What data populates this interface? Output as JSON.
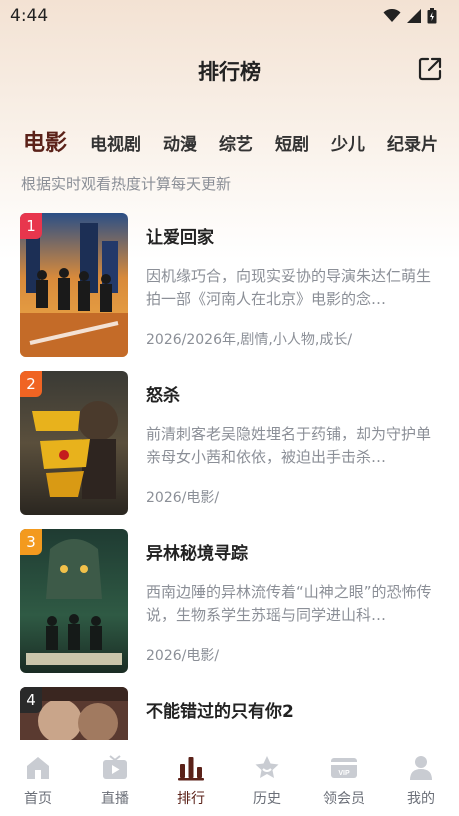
{
  "status": {
    "time": "4:44"
  },
  "header": {
    "title": "排行榜",
    "share_icon": "share-icon"
  },
  "tabs": [
    {
      "label": "电影",
      "active": true
    },
    {
      "label": "电视剧"
    },
    {
      "label": "动漫"
    },
    {
      "label": "综艺"
    },
    {
      "label": "短剧"
    },
    {
      "label": "少儿"
    },
    {
      "label": "纪录片"
    }
  ],
  "subtitle": "根据实时观看热度计算每天更新",
  "items": [
    {
      "rank": "1",
      "title": "让爱回家",
      "desc": "因机缘巧合，向现实妥协的导演朱达仁萌生拍一部《河南人在北京》电影的念…",
      "meta": "2026/2026年,剧情,小人物,成长/"
    },
    {
      "rank": "2",
      "title": "怒杀",
      "desc": "前清刺客老吴隐姓埋名于药铺，却为守护单亲母女小茜和依依，被迫出手击杀…",
      "meta": "2026/电影/"
    },
    {
      "rank": "3",
      "title": "异林秘境寻踪",
      "desc": "西南边陲的异林流传着“山神之眼”的恐怖传说，生物系学生苏瑶与同学进山科…",
      "meta": "2026/电影/"
    },
    {
      "rank": "4",
      "title": "不能错过的只有你2",
      "desc": "",
      "meta": ""
    }
  ],
  "nav": [
    {
      "label": "首页",
      "icon": "home-icon"
    },
    {
      "label": "直播",
      "icon": "tv-icon"
    },
    {
      "label": "排行",
      "icon": "ranking-icon",
      "active": true
    },
    {
      "label": "历史",
      "icon": "history-icon"
    },
    {
      "label": "领会员",
      "icon": "vip-icon"
    },
    {
      "label": "我的",
      "icon": "profile-icon"
    }
  ],
  "colors": {
    "accent": "#5b2219",
    "rank1": "#e8364d",
    "rank2": "#f06423",
    "rank3": "#f39a1e",
    "rank4": "#2a2a2a",
    "muted": "#8b8f97"
  }
}
